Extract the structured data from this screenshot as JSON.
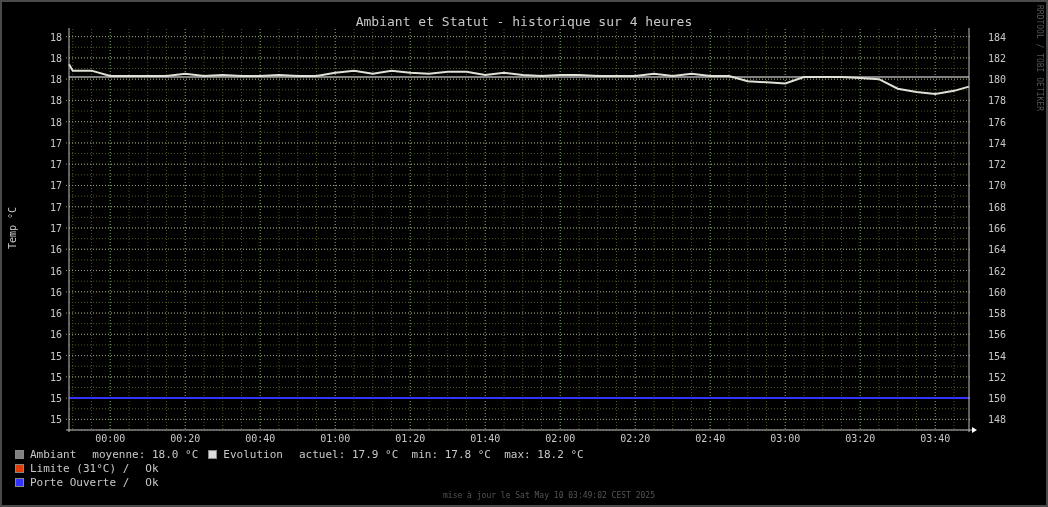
{
  "title": "Ambiant et Statut - historique sur 4 heures",
  "watermark_side": "RRDTOOL / TOBI OETIKER",
  "chart": {
    "left_axis_labels": [
      "18",
      "18",
      "18",
      "18",
      "18",
      "17",
      "17",
      "17",
      "17",
      "17",
      "16",
      "16",
      "16",
      "16",
      "16",
      "15",
      "15",
      "15",
      "15"
    ],
    "chart_data": {
      "type": "line",
      "grid": true,
      "annotations": [
        {
          "text": "Temp °C"
        }
      ],
      "xlim": [
        -11,
        229
      ],
      "ylim": [
        147,
        185
      ],
      "xticks": [
        {
          "value": 0,
          "label": "00:00"
        },
        {
          "value": 20,
          "label": "00:20"
        },
        {
          "value": 40,
          "label": "00:40"
        },
        {
          "value": 60,
          "label": "01:00"
        },
        {
          "value": 80,
          "label": "01:20"
        },
        {
          "value": 100,
          "label": "01:40"
        },
        {
          "value": 120,
          "label": "02:00"
        },
        {
          "value": 140,
          "label": "02:20"
        },
        {
          "value": 160,
          "label": "02:40"
        },
        {
          "value": 180,
          "label": "03:00"
        },
        {
          "value": 200,
          "label": "03:20"
        },
        {
          "value": 220,
          "label": "03:40"
        }
      ],
      "yticks": [
        184,
        182,
        180,
        178,
        176,
        174,
        172,
        170,
        168,
        166,
        164,
        162,
        160,
        158,
        156,
        154,
        152,
        150,
        148
      ],
      "x": [
        -11,
        -10,
        -5,
        0,
        5,
        10,
        15,
        20,
        25,
        30,
        35,
        40,
        45,
        50,
        55,
        60,
        65,
        70,
        75,
        80,
        85,
        90,
        95,
        100,
        105,
        110,
        115,
        120,
        125,
        130,
        135,
        140,
        145,
        150,
        155,
        160,
        165,
        170,
        175,
        180,
        185,
        190,
        195,
        200,
        205,
        210,
        215,
        220,
        225,
        229
      ],
      "series": [
        {
          "color": "#3333ff",
          "values": [
            150,
            150,
            150,
            150,
            150,
            150,
            150,
            150,
            150,
            150,
            150,
            150,
            150,
            150,
            150,
            150,
            150,
            150,
            150,
            150,
            150,
            150,
            150,
            150,
            150,
            150,
            150,
            150,
            150,
            150,
            150,
            150,
            150,
            150,
            150,
            150,
            150,
            150,
            150,
            150,
            150,
            150,
            150,
            150,
            150,
            150,
            150,
            150,
            150,
            150
          ]
        },
        {
          "color": "#808080",
          "values": [
            180.2,
            180.2,
            180.2,
            180.2,
            180.2,
            180.2,
            180.2,
            180.2,
            180.2,
            180.2,
            180.2,
            180.2,
            180.2,
            180.2,
            180.2,
            180.2,
            180.2,
            180.2,
            180.2,
            180.2,
            180.2,
            180.2,
            180.2,
            180.2,
            180.2,
            180.2,
            180.2,
            180.2,
            180.2,
            180.2,
            180.2,
            180.2,
            180.2,
            180.2,
            180.2,
            180.2,
            180.2,
            180.2,
            180.2,
            180.2,
            180.2,
            180.2,
            180.2,
            180.2,
            180.2,
            180.2,
            180.2,
            180.2,
            180.2,
            180.2
          ]
        },
        {
          "color": "#e0e0d8",
          "values": [
            181.4,
            180.8,
            180.8,
            180.3,
            180.3,
            180.3,
            180.3,
            180.5,
            180.3,
            180.4,
            180.3,
            180.3,
            180.4,
            180.3,
            180.3,
            180.6,
            180.8,
            180.5,
            180.8,
            180.6,
            180.5,
            180.7,
            180.7,
            180.4,
            180.6,
            180.4,
            180.3,
            180.4,
            180.4,
            180.3,
            180.3,
            180.3,
            180.5,
            180.3,
            180.5,
            180.3,
            180.3,
            179.8,
            179.7,
            179.6,
            180.2,
            180.2,
            180.2,
            180.1,
            180.0,
            179.1,
            178.8,
            178.6,
            178.9,
            179.3
          ]
        }
      ]
    }
  },
  "legend": [
    [
      {
        "label": "Ambiant",
        "color": "#808080",
        "text": "moyenne: 18.0 °C"
      },
      {
        "label": "Evolution",
        "color": "#dcdcdc",
        "text": "actuel: 17.9 °C  min: 17.8 °C  max: 18.2 °C"
      }
    ],
    [
      {
        "label": "Limite (31°C) /",
        "color": "#e03c0a",
        "text": "Ok"
      }
    ],
    [
      {
        "label": "Porte Ouverte /",
        "color": "#3333ff",
        "text": "Ok"
      }
    ]
  ],
  "footer": "mise à jour le Sat May 10 03:49:02 CEST 2025"
}
